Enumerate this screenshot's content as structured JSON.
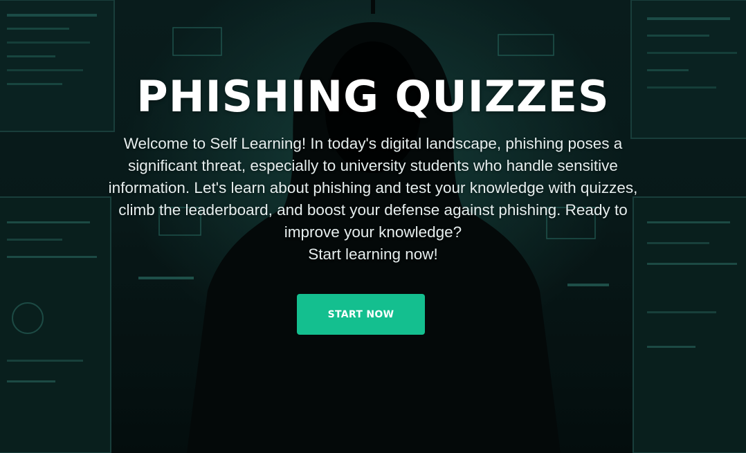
{
  "hero": {
    "title": "PHISHING QUIZZES",
    "description": "Welcome to Self Learning! In today's digital landscape, phishing poses a significant threat, especially to university students who handle sensitive information. Let's learn about phishing and test your knowledge with quizzes, climb the leaderboard, and boost your defense against phishing. Ready to improve your knowledge?",
    "cta_text": "Start learning now!",
    "button_label": "START NOW"
  },
  "colors": {
    "accent": "#14bf8f",
    "background": "#0a1f1f",
    "text": "#ffffff"
  }
}
